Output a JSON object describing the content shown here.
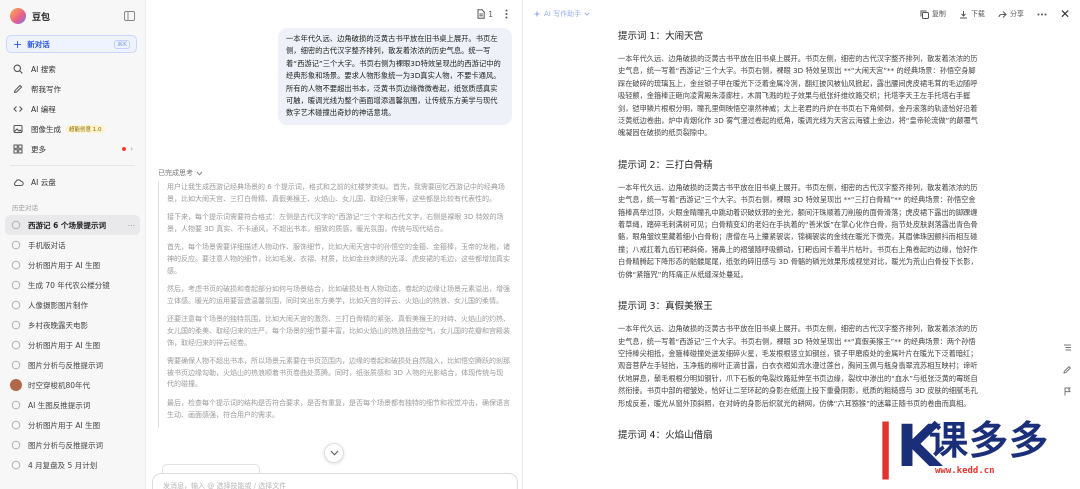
{
  "app": {
    "name": "豆包"
  },
  "sidebar": {
    "new_chat": {
      "label": "新对话",
      "shortcut": "⌘K"
    },
    "nav": [
      {
        "label": "AI 搜索",
        "icon": "search-icon"
      },
      {
        "label": "帮我写作",
        "icon": "pen-icon"
      },
      {
        "label": "AI 编程",
        "icon": "code-icon"
      },
      {
        "label": "图像生成",
        "icon": "image-icon",
        "badge": "超能创意 1.0"
      },
      {
        "label": "更多",
        "icon": "grid-icon"
      }
    ],
    "cloud": {
      "label": "AI 云盘",
      "icon": "cloud-icon"
    },
    "history_title": "历史对话",
    "history": [
      {
        "label": "西游记 6 个场景提示词",
        "active": true
      },
      {
        "label": "手机版对话"
      },
      {
        "label": "分析图片用于 AI 生图"
      },
      {
        "label": "生成 70 年代农公楼分镜"
      },
      {
        "label": "人像摄影图片制作"
      },
      {
        "label": "乡村夜晚露天电影"
      },
      {
        "label": "分析图片用于 AI 生图"
      },
      {
        "label": "图片分析与反推提示词"
      },
      {
        "label": "时空穿梭机80年代",
        "avatar": true
      },
      {
        "label": "AI 生图反推提示词"
      },
      {
        "label": "分析图片用于 AI 生图"
      },
      {
        "label": "图片分析与反推提示词"
      },
      {
        "label": "4 月复盘及 5 月计划"
      }
    ]
  },
  "chat": {
    "doc_count": "1",
    "user_message": "一本年代久远、边角破损的泛黄古书平放在旧书桌上展开。书页左侧，细密的古代汉字整齐排列，散发着浓浓的历史气息。统一写着“西游记”三个大字。书页右侧为裸眼3D特效呈现出的西游记中的经典形象和场景。要求人物形象统一为3D真实人物，不要卡通风。所有的人物不要超出书本，泛黄书页边缘微微卷起，纸张质感真实可触，暖调光线为整个画面增添温馨氛围，让传统东方美学与现代数字艺术碰撞出奇妙的神话意境。",
    "thinking_label": "已完成思考",
    "thinking": [
      "用户让我生成西游记经典场景的 6 个提示词，格式和之前的红楼梦类似。首先，我需要回忆西游记中的经典场景，比如大闹天宫、三打白骨精、真假美猴王、火焰山、女儿国、取经归来等，这些都是比较有代表性的。",
      "接下来，每个提示词需要符合格式：左侧是古代汉字的“西游记”三个字和古代文字，右侧是裸眼 3D 特效的场景，人物要 3D 真实、不卡通风，不超出书本，细致的质感，暖光氛围，传统与现代结合。",
      "首先，每个场景需要详细描述人物动作、服饰细节，比如大闹天宫中的孙悟空的金箍、金箍棒，玉帝的龙袍，诸神的反应。要注意人物的细节，比如毛发、衣褶、材质，比如金丝刺绣的光泽、虎皮裙的毛边，这些都增加真实感。",
      "然后，考虑书页的破损和卷起部分如何与场景结合，比如破损处有人物动态，卷起的边缘让场景元素溢出，增强立体感。暖光的运用要营造温馨氛围，同时突出东方美学，比如天宫的祥云、火焰山的热浪、女儿国的柔情。",
      "还要注意每个场景的独特氛围，比如大闹天宫的激烈、三打白骨精的紧张、真假美猴王的对峙、火焰山的灼热、女儿国的柔美、取经归来的庄严。每个场景的细节要丰富，比如火焰山的热浪扭曲空气，女儿国的花瓣和宫殿装饰，取经归来的祥云经卷。",
      "需要确保人物不超出书本，所以场景元素要在书页范围内，边缘的卷起和破损处自然融入，比如悟空腾跃的刹那被书页边缘勾勒，火焰山的热浪顺着书页卷曲处蒸腾。同时，纸张质感和 3D 人物的光影结合，体现传统与现代的碰撞。",
      "最后，检查每个提示词的结构是否符合要求，是否有重复，是否每个场景都有独特的细节和视觉冲击，确保语言生动、画面感强，符合用户的需求。"
    ],
    "input_placeholder": "发消息，输入 @ 选择技能或 / 选择文件"
  },
  "doc": {
    "mode_label": "AI 写作助手",
    "actions": {
      "copy": "复制",
      "download": "下载",
      "share": "分享"
    },
    "sections": [
      {
        "title": "提示词 1：大闹天宫",
        "body": "一本年代久远、边角破损的泛黄古书平放在旧书桌上展开。书页左侧，细密的古代汉字整齐排列，散发着浓浓的历史气息，统一写着“西游记”三个大字。书页右侧，裸眼 3D 特效呈现出 **“大闹天宫”** 的经典场景：孙悟空身脚踩在破碎的琉璃瓦上，金丝锁子甲在暖光下泛着金属冷冽，翻红披风被仙风掀起，露出腰间虎皮裙毛茸的毛边随呼吸轻颤，金箍棒正砸向凌霄殿朱漆廊柱，木屑飞溅的粒子效果与纸张纤维纹路交织；托塔李天王左手托塔右手握剑，铠甲鳞片根根分明，瞳孔里倒映悟空凛然神威；太上老君的丹炉在书页右下角倾倒，金丹滚落的轨迹恰好沿着泛黄纸边卷曲，炉中青烟化作 3D 雾气漫过卷起的纸角，暖调光线为天宫云海镀上金边，将“皇帝轮流做”的颠覆气魄凝固在破损的纸页裂隙中。"
      },
      {
        "title": "提示词 2：三打白骨精",
        "body": "一本年代久远、边角破损的泛黄古书平放在旧书桌上展开。书页左侧，细密的古代汉字整齐排列，散发着浓浓的历史气息，统一写着“西游记”三个大字。书页右侧，裸眼 3D 特效呈现出 **“三打白骨精”** 的经典场景：孙悟空金箍棒高举过顶，火眼金睛瞳孔中跳动着识破妖邪的金光，额间汗珠顺着刀削般的面骨滑落；虎皮裙下露出的脚踝缠着草绳，踏碎毛刺满树可见；白骨精变幻的老妇在手执着的“善米饭”在掌心化作白骨，指节处皮肤剥落露出青色骨骼，眼角皱纹里藏着细小白骨粉；唐僧在马上攥紧袈裟，锦襕袈裟的金线在暖光下微亮，其眉佛珠因颤抖而相互碰撞；八戒扛着九齿钉耙斜倚，猪鼻上的褶皱随呼吸颤动，钉耙齿间卡着半片枯叶。书页右上角卷起的边缘，恰好作白骨精腾起下降形态的骷髅尾尾，纸张的碎旧感与 3D 骨骼的磷光效果形成视觉对比，暖光为荒山白骨投下长影，仿佛“紧箍咒”的阵痛正从纸缝深处蔓延。"
      },
      {
        "title": "提示词 3：真假美猴王",
        "body": "一本年代久远、边角破损的泛黄古书平放在旧书桌上展开。书页左侧，细密的古代汉字整齐排列，散发着浓浓的历史气息，统一写着“西游记”三个大字。书页右侧，裸眼 3D 特效呈现出 **“真假美猴王”** 的经典场景：两个孙悟空持棒尖相抵，金箍棒碰撞处迸发细碎火星，毛发根根竖立如钢丝，锁子甲磨痕处的金属叶片在暖光下泛着暗红；观音菩萨左手轻抬，玉净瓶的柳叶正滴甘露，白衣衣褶如流水漫过莲台，胸间玉佩与瓶身翡翠流苏相互映衬；谛听伏地屏息，鬃毛根根分明如钢针，爪下石板的龟裂纹路延伸至书页边缘，裂纹中渗出的“血水”与纸张泛黄的霉斑自然衔接。书页中部的褶皱处，恰好让二至环起的身影在纸面上投下重叠阴影，纸质的粗糙感与 3D 皮肤的细腻毛孔形成反差，暖光从窗外顶斜照，在对峙的身影后织就光的耕网，仿佛“六耳猕猴”的迷幕正随书页的卷曲而真相。"
      },
      {
        "title": "提示词 4：火焰山借扇",
        "body": ""
      }
    ]
  },
  "watermark": {
    "k": "K",
    "text": "课多多",
    "url": "www.kedd.cn"
  },
  "colors": {
    "accent": "#2b56e8",
    "watermark_blue": "#1a2e7a",
    "watermark_red": "#e5322d"
  }
}
